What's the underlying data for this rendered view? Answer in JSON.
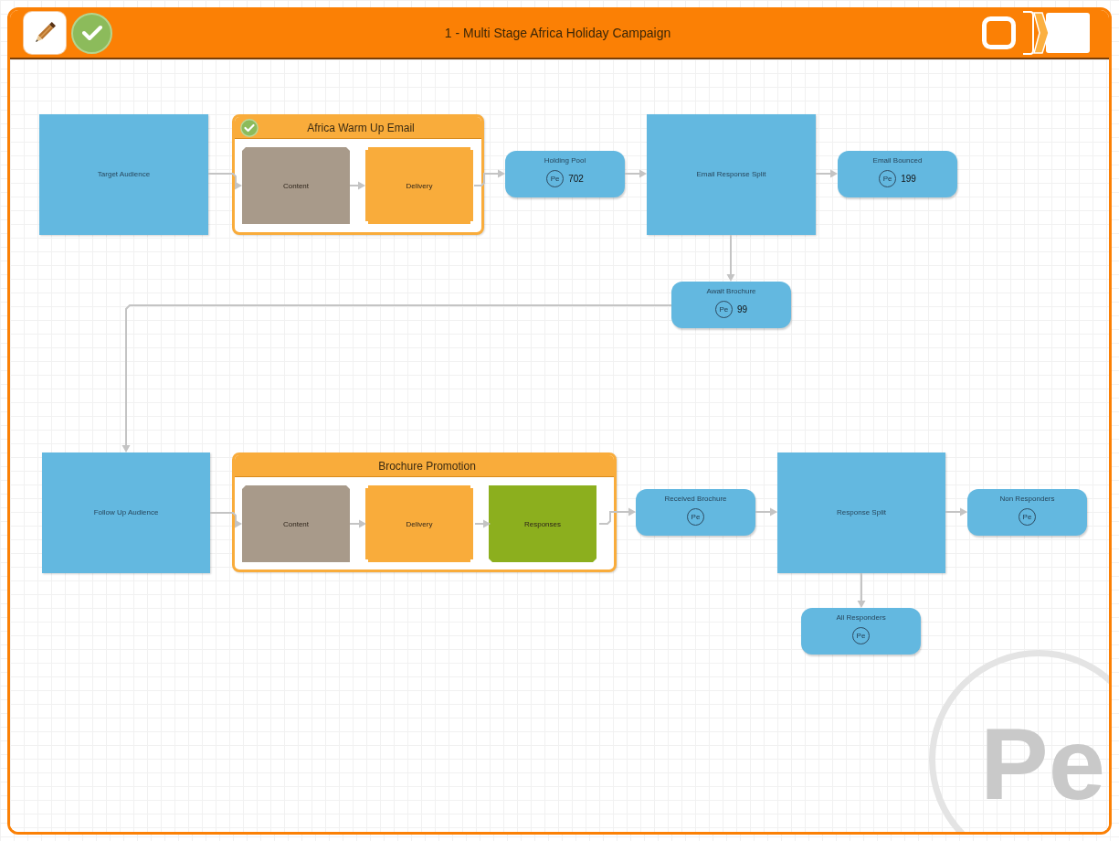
{
  "window": {
    "title": "1 - Multi Stage Africa Holiday Campaign"
  },
  "toolbar": {
    "left": [
      {
        "kind": "edit"
      },
      {
        "kind": "approve"
      }
    ],
    "right": [
      {
        "kind": "frame"
      },
      {
        "kind": "panel"
      }
    ]
  },
  "diagram": {
    "nodes": [
      {
        "kind": "audience",
        "label": "Target Audience"
      },
      {
        "kind": "group",
        "title": "Africa Warm Up Email",
        "checked": true,
        "steps": [
          {
            "kind": "content",
            "label": "Content"
          },
          {
            "kind": "delivery",
            "label": "Delivery"
          }
        ]
      },
      {
        "kind": "pool",
        "label": "Holding Pool",
        "badge": "Pe",
        "count": "702"
      },
      {
        "kind": "split",
        "label": "Email Response Split"
      },
      {
        "kind": "pool",
        "label": "Email Bounced",
        "badge": "Pe",
        "count": "199"
      },
      {
        "kind": "pool",
        "label": "Await Brochure",
        "badge": "Pe",
        "count": "99"
      },
      {
        "kind": "audience",
        "label": "Follow Up Audience"
      },
      {
        "kind": "group",
        "title": "Brochure Promotion",
        "checked": false,
        "steps": [
          {
            "kind": "content",
            "label": "Content"
          },
          {
            "kind": "delivery",
            "label": "Delivery"
          },
          {
            "kind": "responses",
            "label": "Responses"
          }
        ]
      },
      {
        "kind": "pool",
        "label": "Received Brochure",
        "badge": "Pe"
      },
      {
        "kind": "split",
        "label": "Response Split"
      },
      {
        "kind": "pool",
        "label": "Non Responders",
        "badge": "Pe"
      },
      {
        "kind": "pool",
        "label": "All Responders",
        "badge": "Pe"
      }
    ],
    "background_logo": "Pe"
  }
}
